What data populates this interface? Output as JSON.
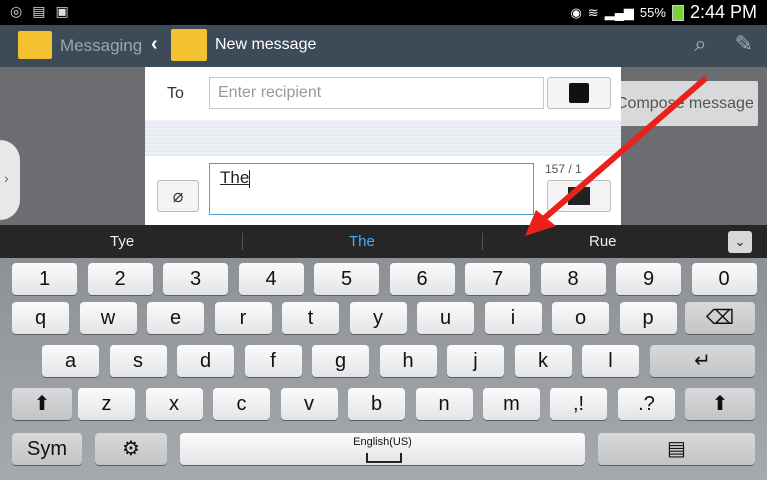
{
  "status_bar": {
    "battery": "55%",
    "time": "2:44 PM"
  },
  "app_bar": {
    "title": "Messaging"
  },
  "background": {
    "compose_button": "Compose message"
  },
  "dialog": {
    "title": "New message",
    "to_label": "To",
    "recipient_placeholder": "Enter recipient",
    "message_text": "The",
    "counter": "157 / 1"
  },
  "suggestions": [
    "Tye",
    "The",
    "Rue"
  ],
  "keyboard": {
    "row_numbers": [
      "1",
      "2",
      "3",
      "4",
      "5",
      "6",
      "7",
      "8",
      "9",
      "0"
    ],
    "row_q": [
      "q",
      "w",
      "e",
      "r",
      "t",
      "y",
      "u",
      "i",
      "o",
      "p"
    ],
    "row_a": [
      "a",
      "s",
      "d",
      "f",
      "g",
      "h",
      "j",
      "k",
      "l"
    ],
    "row_z": [
      "z",
      "x",
      "c",
      "v",
      "b",
      "n",
      "m"
    ],
    "comma_key": ",!",
    "period_key": ".?",
    "sym": "Sym",
    "space_label": "English(US)"
  },
  "colors": {
    "accent": "#3fb0ff",
    "appbar": "#3d4a57",
    "annotation_arrow": "#e8221b"
  },
  "icons": [
    "settings-icon",
    "wifi-icon",
    "signal-icon",
    "battery-icon",
    "search-icon",
    "compose-icon",
    "back-icon",
    "contact-icon",
    "attach-icon",
    "send-icon",
    "backspace-icon",
    "enter-icon",
    "shift-icon",
    "settings-gear-icon",
    "clipboard-icon"
  ]
}
